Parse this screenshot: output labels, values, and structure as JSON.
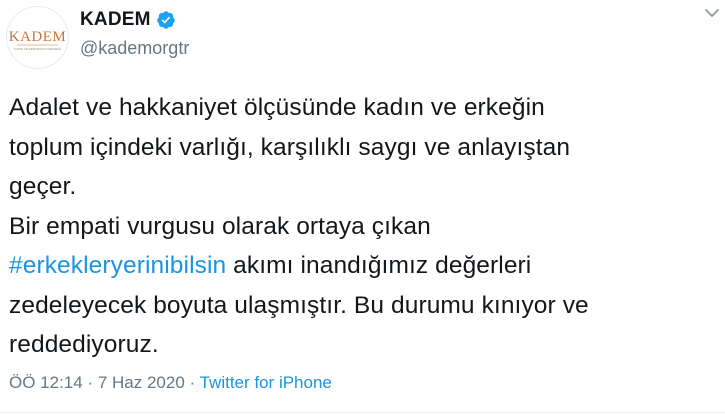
{
  "author": {
    "display_name": "KADEM",
    "handle": "@kademorgtr",
    "avatar_logo_text": "KADEM",
    "avatar_logo_subtext": "KADIN VE DEMOKRASİ DERNEĞİ",
    "verified": true
  },
  "tweet": {
    "line1": "Adalet ve hakkaniyet ölçüsünde kadın ve erkeğin",
    "line2": "toplum içindeki varlığı, karşılıklı saygı ve anlayıştan",
    "line3": "geçer.",
    "line4": "Bir empati vurgusu olarak ortaya çıkan",
    "hashtag": "#erkekleryerinibilsin",
    "line5_rest": " akımı inandığımız değerleri",
    "line6": "zedeleyecek boyuta ulaşmıştır. Bu durumu kınıyor ve",
    "line7": "reddediyoruz."
  },
  "meta": {
    "time": "ÖÖ 12:14",
    "separator1": " · ",
    "date": "7 Haz 2020",
    "separator2": " · ",
    "source": "Twitter for iPhone"
  },
  "icons": {
    "verified": "verified-badge-icon",
    "menu": "chevron-down-icon"
  },
  "colors": {
    "link": "#1b95e0",
    "secondary_text": "#657786",
    "logo_orange": "#c8743a"
  }
}
